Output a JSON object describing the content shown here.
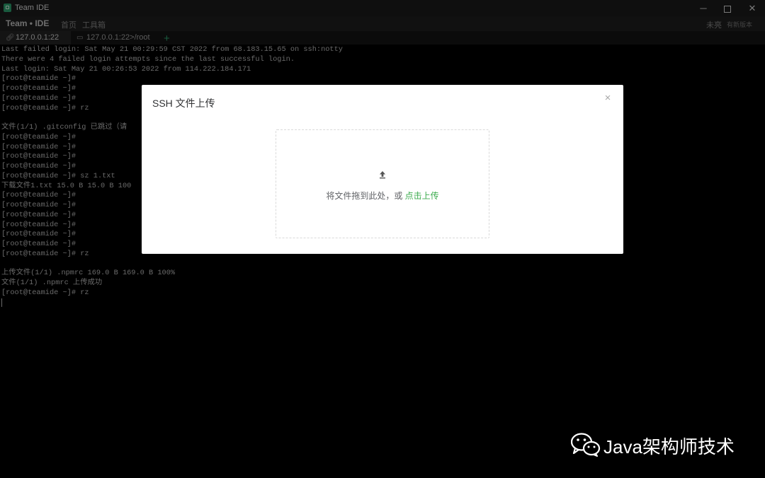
{
  "window": {
    "title": "Team IDE",
    "minimize_glyph": "─",
    "close_glyph": "✕"
  },
  "menubar": {
    "brand": "Team • IDE",
    "home": "首页",
    "tools": "工具箱",
    "user": "未亮",
    "new_version": "有新版本"
  },
  "tabs": [
    {
      "label": "127.0.0.1:22",
      "icon": "link-icon",
      "active": true
    },
    {
      "label": "127.0.0.1:22>/root",
      "icon": "terminal-icon",
      "active": false
    }
  ],
  "add_tab": "+",
  "terminal": {
    "lines": [
      "Last failed login: Sat May 21 00:29:59 CST 2022 from 68.183.15.65 on ssh:notty",
      "There were 4 failed login attempts since the last successful login.",
      "Last login: Sat May 21 00:26:53 2022 from 114.222.184.171",
      "[root@teamide ~]#",
      "[root@teamide ~]#",
      "[root@teamide ~]#",
      "[root@teamide ~]# rz",
      "",
      "文件(1/1) .gitconfig 已跳过（请",
      "[root@teamide ~]#",
      "[root@teamide ~]#",
      "[root@teamide ~]#",
      "[root@teamide ~]#",
      "[root@teamide ~]# sz 1.txt",
      "下载文件1.txt 15.0 B 15.0 B 100",
      "[root@teamide ~]#",
      "[root@teamide ~]#",
      "[root@teamide ~]#",
      "[root@teamide ~]#",
      "[root@teamide ~]#",
      "[root@teamide ~]#",
      "[root@teamide ~]# rz",
      "",
      "上传文件(1/1) .npmrc 169.0 B 169.0 B 100%",
      "文件(1/1) .npmrc 上传成功",
      "[root@teamide ~]# rz"
    ]
  },
  "modal": {
    "title": "SSH 文件上传",
    "close_glyph": "×",
    "drop_text": "将文件拖到此处，或 ",
    "upload_link": "点击上传"
  },
  "watermark": {
    "text": "Java架构师技术"
  },
  "colors": {
    "accent": "#3dac4f",
    "terminal_bg": "#000000",
    "terminal_text": "#c0c0c0"
  }
}
